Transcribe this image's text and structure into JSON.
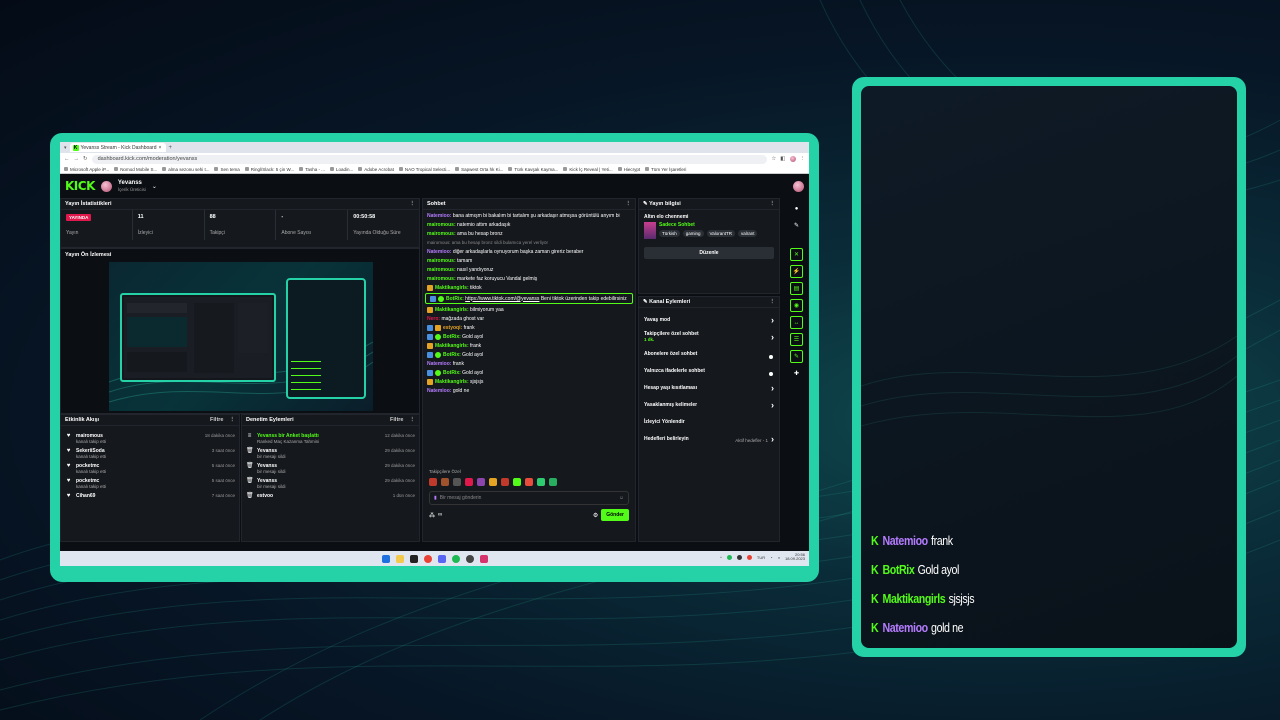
{
  "browser": {
    "tab_title": "Yevanss Stream - Kick Dashboard",
    "url": "dashboard.kick.com/moderation/yevanss",
    "bookmarks": [
      "Microsoft Apple iP...",
      "Nomod Mobile S...",
      "alma sezonu sehi t...",
      "Sen tema",
      "Ringl/Slack: 5 çin W...",
      "Tasha - ...",
      "Loadin...",
      "Adobe Acrobat",
      "NAO Tropical Selecti...",
      "Sapwest Orta hk Ki...",
      "Türk Kavşak Kayma...",
      "Kick İç Reveal | Yeti...",
      "Hiecrypt",
      "Tüm Yer İşaretleri"
    ]
  },
  "header": {
    "logo": "KICK",
    "user_name": "Yevanss",
    "user_role": "İçerik Üreticisi"
  },
  "stats": {
    "title": "Yayın İstatistikleri",
    "items": [
      {
        "value": "YAYINDA",
        "label": "Yayın"
      },
      {
        "value": "11",
        "label": "İzleyici"
      },
      {
        "value": "88",
        "label": "Takipçi"
      },
      {
        "value": "-",
        "label": "Abone Sayısı"
      },
      {
        "value": "00:50:58",
        "label": "Yayında Olduğu Süre"
      }
    ]
  },
  "preview": {
    "title": "Yayın Ön İzlemesi"
  },
  "activity": {
    "title": "Etkinlik Akışı",
    "filter": "Filtre",
    "rows": [
      {
        "name": "mairomous",
        "sub": "kanalı takip etti",
        "time": "18 dakika önce"
      },
      {
        "name": "SekeriiSoda",
        "sub": "kanalı takip etti",
        "time": "3 saat önce"
      },
      {
        "name": "pocketmc",
        "sub": "kanalı takip etti",
        "time": "5 saat önce"
      },
      {
        "name": "pocketmc",
        "sub": "kanalı takip etti",
        "time": "5 saat önce"
      },
      {
        "name": "Cihan69",
        "sub": "",
        "time": "7 saat önce"
      }
    ]
  },
  "moderation": {
    "title": "Denetim Eylemleri",
    "filter": "Filtre",
    "rows": [
      {
        "name": "Yevanss bir Anket başlattı",
        "sub": "Ranked Maç Kazanma Tahmini",
        "time": "12 dakika önce"
      },
      {
        "name": "Yevanss",
        "sub": "bir mesajı sildi",
        "time": "29 dakika önce"
      },
      {
        "name": "Yevanss",
        "sub": "bir mesajı sildi",
        "time": "29 dakika önce"
      },
      {
        "name": "Yevanss",
        "sub": "bir mesajı sildi",
        "time": "29 dakika önce"
      },
      {
        "name": "estvoo",
        "sub": "",
        "time": "1 dün önce"
      }
    ]
  },
  "chat": {
    "title": "Sohbet",
    "messages": [
      {
        "user": "Natemioo",
        "color": "#b57cff",
        "text": "bana atmışm bi bakalım bi tartalım şu arkadaşır atmışsa görüntülü anyım bi",
        "badges": []
      },
      {
        "user": "mairomous",
        "color": "#53fc18",
        "text": "natemio attım arkadaşık",
        "badges": []
      },
      {
        "user": "mairomous",
        "color": "#53fc18",
        "text": "ama bu hesap bronz",
        "badges": []
      },
      {
        "user": "",
        "color": "#888888",
        "text": "mairomous: ama bu hesap bronz sildi bulamıca yerel verliyör",
        "badges": [],
        "system": true
      },
      {
        "user": "Natemioo",
        "color": "#b57cff",
        "text": "diğer arkadaşlarla oynuyorum başka zaman gireriz beraber",
        "badges": []
      },
      {
        "user": "mairomous",
        "color": "#53fc18",
        "text": "tamam",
        "badges": []
      },
      {
        "user": "mairomous",
        "color": "#53fc18",
        "text": "nasıl yandıyoruz",
        "badges": []
      },
      {
        "user": "mairomous",
        "color": "#53fc18",
        "text": "markete faz koruyucu Vandal gelmiş",
        "badges": []
      },
      {
        "user": "Maktikangirls",
        "color": "#53fc18",
        "text": "tiktok",
        "badges": [
          "gold"
        ]
      },
      {
        "user": "BotRix",
        "color": "#53fc18",
        "text": "Beni tiktok üzerinden takip edebilirsiniz",
        "link": "https://www.tiktok.com/@yevanss",
        "badges": [
          "blue",
          "green"
        ],
        "highlight": true
      },
      {
        "user": "Maktikangirls",
        "color": "#53fc18",
        "text": "bilmiyorum yaa",
        "badges": [
          "gold"
        ]
      },
      {
        "user": "Nero",
        "color": "#e0184b",
        "text": "mağzada ghost var",
        "badges": []
      },
      {
        "user": "estyoqi",
        "color": "#e5a323",
        "text": "frank",
        "badges": [
          "blue",
          "gold"
        ]
      },
      {
        "user": "BotRix",
        "color": "#53fc18",
        "text": "Gold ayol",
        "badges": [
          "blue",
          "green"
        ]
      },
      {
        "user": "Maktikangirls",
        "color": "#53fc18",
        "text": "frank",
        "badges": [
          "gold"
        ]
      },
      {
        "user": "BotRix",
        "color": "#53fc18",
        "text": "Gold ayol",
        "badges": [
          "blue",
          "green"
        ]
      },
      {
        "user": "Natemioo",
        "color": "#b57cff",
        "text": "frank",
        "badges": []
      },
      {
        "user": "BotRix",
        "color": "#53fc18",
        "text": "Gold ayol",
        "badges": [
          "blue",
          "green"
        ]
      },
      {
        "user": "Maktikangirls",
        "color": "#53fc18",
        "text": "sjsjsjs",
        "badges": [
          "gold"
        ]
      },
      {
        "user": "Natemioo",
        "color": "#b57cff",
        "text": "gold ne",
        "badges": []
      }
    ],
    "emote_section": "Takipçilere Özel",
    "input_placeholder": "Bir mesaj gönderin",
    "counter": "∞",
    "send_label": "Gönder"
  },
  "stream_info": {
    "title": "Yayın bilgisi",
    "stream_title": "Altın elo chennemi",
    "category": "Sadece Sohbet",
    "tags": [
      "Türkish",
      "gaming",
      "ValorantTR",
      "valrant"
    ],
    "edit_label": "Düzenle"
  },
  "channel_actions": {
    "title": "Kanal Eylemleri",
    "rows": [
      {
        "label": "Yavaş mod",
        "control": "chevron"
      },
      {
        "label": "Takipçilere özel sohbet",
        "sub": "1 dk.",
        "control": "chevron"
      },
      {
        "label": "Abonelere özel sohbet",
        "control": "toggle"
      },
      {
        "label": "Yalnızca ifadelerle sohbet",
        "control": "toggle"
      },
      {
        "label": "Hesap yaşı kısıtlaması",
        "control": "chevron"
      },
      {
        "label": "Yasaklanmış kelimeler",
        "control": "chevron"
      },
      {
        "label": "İzleyici Yönlendir",
        "control": "none"
      },
      {
        "label": "Hedefleri belirleyin",
        "sub": "Aktif hedefler - 1",
        "control": "chevron"
      }
    ]
  },
  "taskbar": {
    "lang": "TUR",
    "time": "20:56",
    "date": "18.09.2023"
  },
  "overlay_chat": [
    {
      "user": "Natemioo",
      "color": "#b57cff",
      "text": "frank"
    },
    {
      "user": "BotRix",
      "color": "#53fc18",
      "text": "Gold ayol"
    },
    {
      "user": "Maktikangirls",
      "color": "#53fc18",
      "text": "sjsjsjs"
    },
    {
      "user": "Natemioo",
      "color": "#b57cff",
      "text": "gold ne"
    }
  ]
}
